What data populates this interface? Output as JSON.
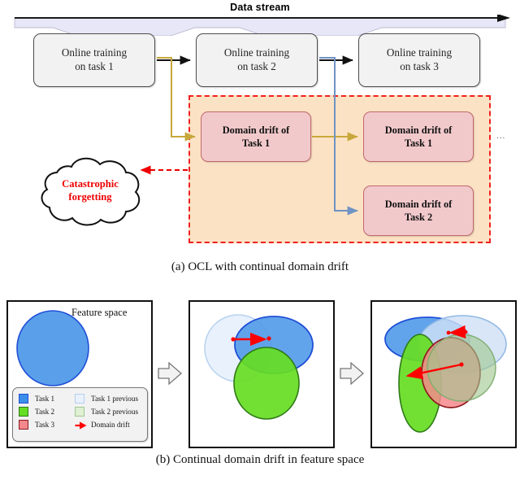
{
  "figure": {
    "panel_a": {
      "stream_title": "Data stream",
      "ellipsis": "...",
      "caption": "(a) OCL with continual domain drift",
      "training_boxes": [
        {
          "line1": "Online training",
          "line2": "on task 1"
        },
        {
          "line1": "Online training",
          "line2": "on task 2"
        },
        {
          "line1": "Online training",
          "line2": "on task 3"
        }
      ],
      "drift_boxes": [
        {
          "line1": "Domain drift of",
          "line2": "Task 1"
        },
        {
          "line1": "Domain drift of",
          "line2": "Task 1"
        },
        {
          "line1": "Domain drift of",
          "line2": "Task 2"
        }
      ],
      "cloud": {
        "line1": "Catastrophic",
        "line2": "forgetting"
      },
      "colors": {
        "stream_band": "#e7e7f7",
        "stream_arrow": "#1a1a1a",
        "training_box_fill": "#f2f2f2",
        "training_box_stroke": "#4d4d4d",
        "drift_box_fill": "#f2c9cb",
        "drift_box_stroke": "#c0686c",
        "drift_region_fill": "#fce2c4",
        "drift_region_stroke": "#ef2020",
        "connector_yellow": "#c8a83c",
        "connector_blue": "#6f93c4",
        "forgetting_text": "#ee0000"
      }
    },
    "panel_b": {
      "feature_space_label": "Feature space",
      "caption": "(b) Continual domain drift in feature space",
      "legend": [
        {
          "name": "Task 1",
          "swatch": "task1-swatch",
          "fill": "#3b8fe8",
          "stroke": "#1f4fd8"
        },
        {
          "name": "Task 1 previous",
          "swatch": "task1-previous-swatch",
          "fill": "#e4eefb",
          "stroke": "#9fc2e8"
        },
        {
          "name": "Task 2",
          "swatch": "task2-swatch",
          "fill": "#66dd22",
          "stroke": "#2f7a17"
        },
        {
          "name": "Task 2 previous",
          "swatch": "task2-previous-swatch",
          "fill": "#dff0d4",
          "stroke": "#8fbf7f"
        },
        {
          "name": "Task 3",
          "swatch": "task3-swatch",
          "fill": "#f4888c",
          "stroke": "#8e1b20"
        },
        {
          "name": "Domain drift",
          "swatch": "domain-drift-arrow",
          "fill": "#ff0000",
          "stroke": "#ff0000"
        }
      ],
      "step_arrow_icon": "block-arrow-right-icon",
      "stages": [
        {
          "name": "stage-1",
          "shapes": [
            "task1"
          ]
        },
        {
          "name": "stage-2",
          "shapes": [
            "task1-previous",
            "task1",
            "task2"
          ]
        },
        {
          "name": "stage-3",
          "shapes": [
            "task1-previous",
            "task1",
            "task2-previous",
            "task2",
            "task3"
          ]
        }
      ]
    }
  }
}
